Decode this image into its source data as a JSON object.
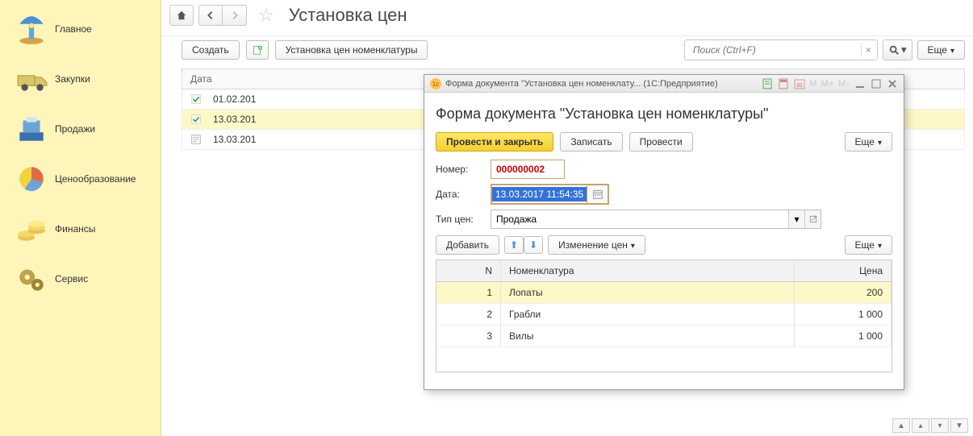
{
  "sidebar": {
    "items": [
      {
        "label": "Главное",
        "icon": "lamp"
      },
      {
        "label": "Закупки",
        "icon": "truck"
      },
      {
        "label": "Продажи",
        "icon": "cashreg"
      },
      {
        "label": "Ценообразование",
        "icon": "piechart"
      },
      {
        "label": "Финансы",
        "icon": "coins"
      },
      {
        "label": "Сервис",
        "icon": "gears"
      }
    ]
  },
  "header": {
    "title": "Установка цен"
  },
  "toolbar": {
    "create": "Создать",
    "priceset": "Установка цен номенклатуры",
    "search_placeholder": "Поиск (Ctrl+F)",
    "more": "Еще"
  },
  "list": {
    "date_header": "Дата",
    "rows": [
      {
        "date": "01.02.201",
        "status": "posted"
      },
      {
        "date": "13.03.201",
        "status": "posted",
        "selected": true
      },
      {
        "date": "13.03.201",
        "status": "draft"
      }
    ]
  },
  "dialog": {
    "titlebar": {
      "text": "Форма документа \"Установка цен номенклату...   (1С:Предприятие)",
      "m_label": "M  M+  M-"
    },
    "heading": "Форма документа \"Установка цен номенклатуры\"",
    "buttons": {
      "post_close": "Провести и закрыть",
      "save": "Записать",
      "post": "Провести",
      "more": "Еще"
    },
    "fields": {
      "number_label": "Номер:",
      "number_value": "000000002",
      "date_label": "Дата:",
      "date_value": "13.03.2017 11:54:35",
      "type_label": "Тип цен:",
      "type_value": "Продажа"
    },
    "grid_toolbar": {
      "add": "Добавить",
      "change": "Изменение цен",
      "more": "Еще"
    },
    "grid": {
      "headers": {
        "n": "N",
        "name": "Номенклатура",
        "price": "Цена"
      },
      "rows": [
        {
          "n": "1",
          "name": "Лопаты",
          "price": "200",
          "selected": true
        },
        {
          "n": "2",
          "name": "Грабли",
          "price": "1 000"
        },
        {
          "n": "3",
          "name": "Вилы",
          "price": "1 000"
        }
      ]
    }
  }
}
